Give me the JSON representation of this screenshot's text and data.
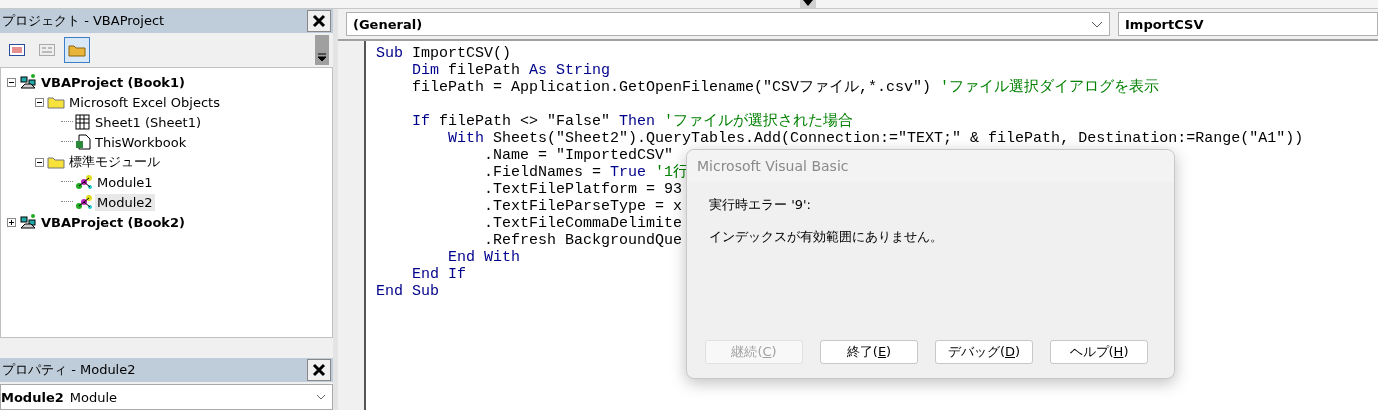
{
  "project_pane": {
    "title": "プロジェクト - VBAProject",
    "tools": [
      {
        "kind": "code",
        "selected": false,
        "disabled": false
      },
      {
        "kind": "object",
        "selected": false,
        "disabled": true
      },
      {
        "kind": "folders",
        "selected": true,
        "disabled": false
      }
    ],
    "tree": [
      {
        "label": "VBAProject (Book1)",
        "kind": "project",
        "expanded": true,
        "selected": false,
        "children": [
          {
            "label": "Microsoft Excel Objects",
            "kind": "folder",
            "expanded": true,
            "selected": false,
            "children": [
              {
                "label": "Sheet1 (Sheet1)",
                "kind": "sheet",
                "selected": false
              },
              {
                "label": "ThisWorkbook",
                "kind": "workbook",
                "selected": false
              }
            ]
          },
          {
            "label": "標準モジュール",
            "kind": "folder",
            "expanded": true,
            "selected": false,
            "children": [
              {
                "label": "Module1",
                "kind": "module",
                "selected": false
              },
              {
                "label": "Module2",
                "kind": "module",
                "selected": true
              }
            ]
          }
        ]
      },
      {
        "label": "VBAProject (Book2)",
        "kind": "project",
        "expanded": false,
        "selected": false
      }
    ]
  },
  "properties_pane": {
    "title": "プロパティ - Module2",
    "object_name": "Module2",
    "object_type": "Module"
  },
  "object_combo": {
    "value": "(General)"
  },
  "procedure_combo": {
    "value": "ImportCSV"
  },
  "code_lines": [
    {
      "kind": "code",
      "tokens": [
        {
          "kind": "keyword",
          "text": "Sub"
        },
        {
          "kind": "plain",
          "text": " ImportCSV()"
        }
      ]
    },
    {
      "kind": "code",
      "tokens": [
        {
          "kind": "keyword",
          "text": "    Dim"
        },
        {
          "kind": "plain",
          "text": " filePath "
        },
        {
          "kind": "keyword",
          "text": "As String"
        }
      ]
    },
    {
      "kind": "code",
      "tokens": [
        {
          "kind": "plain",
          "text": "    filePath = Application.GetOpenFilename(\"CSVファイル,*.csv\") "
        },
        {
          "kind": "comment",
          "text": "'ファイル選択ダイアログを表示"
        }
      ]
    },
    {
      "kind": "blank"
    },
    {
      "kind": "code",
      "tokens": [
        {
          "kind": "keyword",
          "text": "    If"
        },
        {
          "kind": "plain",
          "text": " filePath <> \"False\" "
        },
        {
          "kind": "keyword",
          "text": "Then"
        },
        {
          "kind": "comment",
          "text": " 'ファイルが選択された場合"
        }
      ]
    },
    {
      "kind": "code",
      "tokens": [
        {
          "kind": "keyword",
          "text": "        With"
        },
        {
          "kind": "plain",
          "text": " Sheets(\"Sheet2\").QueryTables.Add(Connection:=\"TEXT;\" & filePath, Destination:=Range(\"A1\"))"
        }
      ]
    },
    {
      "kind": "code",
      "tokens": [
        {
          "kind": "plain",
          "text": "            .Name = \"ImportedCSV\""
        }
      ]
    },
    {
      "kind": "code",
      "tokens": [
        {
          "kind": "plain",
          "text": "            .FieldNames = "
        },
        {
          "kind": "keyword",
          "text": "True"
        },
        {
          "kind": "comment",
          "text": " '1行"
        }
      ]
    },
    {
      "kind": "code",
      "tokens": [
        {
          "kind": "plain",
          "text": "            .TextFilePlatform = 93"
        }
      ]
    },
    {
      "kind": "code",
      "tokens": [
        {
          "kind": "plain",
          "text": "            .TextFileParseType = x"
        }
      ]
    },
    {
      "kind": "code",
      "tokens": [
        {
          "kind": "plain",
          "text": "            .TextFileCommaDelimite"
        }
      ]
    },
    {
      "kind": "code",
      "tokens": [
        {
          "kind": "plain",
          "text": "            .Refresh BackgroundQue"
        }
      ]
    },
    {
      "kind": "code",
      "tokens": [
        {
          "kind": "keyword",
          "text": "        End With"
        }
      ]
    },
    {
      "kind": "code",
      "tokens": [
        {
          "kind": "keyword",
          "text": "    End If"
        }
      ]
    },
    {
      "kind": "code",
      "tokens": [
        {
          "kind": "keyword",
          "text": "End Sub"
        }
      ]
    }
  ],
  "dialog": {
    "title": "Microsoft Visual Basic",
    "heading": "実行時エラー '9':",
    "message": "インデックスが有効範囲にありません。",
    "buttons": [
      {
        "before": "継続(",
        "key": "C",
        "after": ")",
        "disabled": true
      },
      {
        "before": "終了(",
        "key": "E",
        "after": ")",
        "disabled": false
      },
      {
        "before": "デバッグ(",
        "key": "D",
        "after": ")",
        "disabled": false
      },
      {
        "before": "ヘルプ(",
        "key": "H",
        "after": ")",
        "disabled": false
      }
    ]
  }
}
